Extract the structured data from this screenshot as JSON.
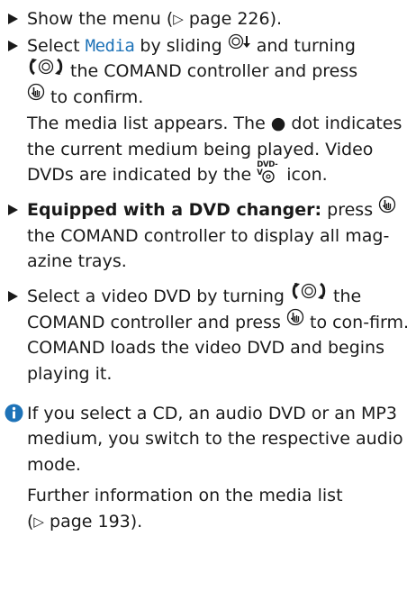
{
  "steps": [
    {
      "pre": "Show the menu (",
      "arrow": "▷",
      "post": " page 226)."
    },
    {
      "t1": "Select ",
      "highlight": "Media",
      "t2": " by sliding ",
      "t3": " and turning",
      "t4": " the COMAND controller and press",
      "t5": " to confirm.",
      "result1": "The media list appears. The ● dot indicates the current medium being played. Video DVDs are indicated by the ",
      "icon_label": "DVD-V",
      "result2": " icon."
    },
    {
      "bold": "Equipped with a DVD changer:",
      "t1": " press ",
      "t2": "the COMAND controller to display all mag-azine trays."
    },
    {
      "t1": "Select a video DVD by turning ",
      "t2": " the COMAND controller and press ",
      "t3": " to con-firm.",
      "result": "COMAND loads the video DVD and begins playing it."
    }
  ],
  "note": {
    "p1": "If you select a CD, an audio DVD or an MP3 medium, you switch to the respective audio mode.",
    "p2a": "Further information on the media list",
    "arrow": "▷",
    "p2b": " page 193)."
  },
  "colors": {
    "accent": "#1e73b8",
    "text": "#1a1a1a"
  },
  "icons": [
    "step-triangle-icon",
    "slide-down-controller-icon",
    "turn-controller-icon",
    "press-controller-icon",
    "dvd-video-icon",
    "info-icon"
  ]
}
